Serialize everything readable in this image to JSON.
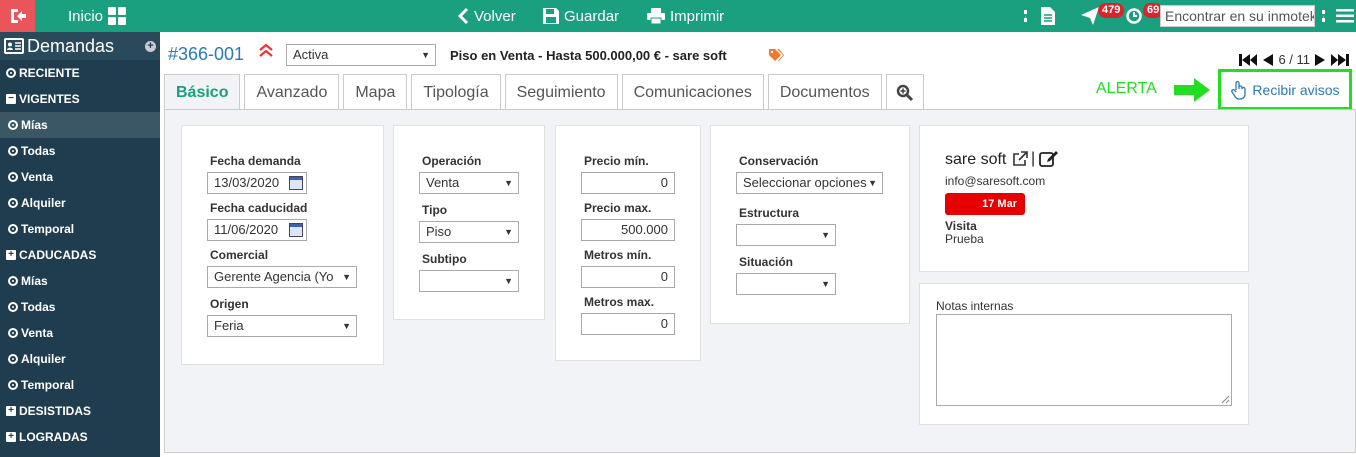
{
  "topbar": {
    "home": "Inicio",
    "back": "Volver",
    "save": "Guardar",
    "print": "Imprimir",
    "badge_messages": "479",
    "badge_tasks": "69",
    "search_placeholder": "Encontrar en su inmotek"
  },
  "sidebar": {
    "title": "Demandas",
    "items": [
      {
        "label": "RECIENTE"
      },
      {
        "label": "VIGENTES"
      },
      {
        "label": "Mías"
      },
      {
        "label": "Todas"
      },
      {
        "label": "Venta"
      },
      {
        "label": "Alquiler"
      },
      {
        "label": "Temporal"
      },
      {
        "label": "CADUCADAS"
      },
      {
        "label": "Mías"
      },
      {
        "label": "Todas"
      },
      {
        "label": "Venta"
      },
      {
        "label": "Alquiler"
      },
      {
        "label": "Temporal"
      },
      {
        "label": "DESISTIDAS"
      },
      {
        "label": "LOGRADAS"
      }
    ]
  },
  "record": {
    "id": "#366-001",
    "status": "Activa",
    "description": "Piso en Venta - Hasta 500.000,00 € - sare soft",
    "pager": "6 / 11"
  },
  "tabs": [
    "Básico",
    "Avanzado",
    "Mapa",
    "Tipología",
    "Seguimiento",
    "Comunicaciones",
    "Documentos"
  ],
  "alerta": "ALERTA",
  "recibir_avisos": "Recibir avisos",
  "form": {
    "fecha_demanda_label": "Fecha demanda",
    "fecha_demanda": "13/03/2020",
    "fecha_caducidad_label": "Fecha caducidad",
    "fecha_caducidad": "11/06/2020",
    "comercial_label": "Comercial",
    "comercial": "Gerente Agencia (Yo",
    "origen_label": "Origen",
    "origen": "Feria",
    "operacion_label": "Operación",
    "operacion": "Venta",
    "tipo_label": "Tipo",
    "tipo": "Piso",
    "subtipo_label": "Subtipo",
    "subtipo": "",
    "precio_min_label": "Precio mín.",
    "precio_min": "0",
    "precio_max_label": "Precio max.",
    "precio_max": "500.000",
    "metros_min_label": "Metros mín.",
    "metros_min": "0",
    "metros_max_label": "Metros max.",
    "metros_max": "0",
    "conservacion_label": "Conservación",
    "conservacion": "Seleccionar opciones",
    "estructura_label": "Estructura",
    "estructura": "",
    "situacion_label": "Situación",
    "situacion": ""
  },
  "contact": {
    "name": "sare soft",
    "separator": "|",
    "email": "info@saresoft.com",
    "date": "17 Mar",
    "visit_label": "Visita",
    "visit_value": "Prueba"
  },
  "notes": {
    "label": "Notas internas"
  }
}
